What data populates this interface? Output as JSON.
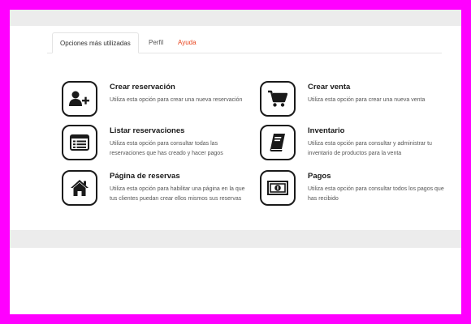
{
  "tabs": [
    {
      "label": "Opciones más utilizadas",
      "active": true
    },
    {
      "label": "Perfil",
      "active": false
    },
    {
      "label": "Ayuda",
      "active": false
    }
  ],
  "accent_color": "#e8441d",
  "frame_color": "#ff00ff",
  "options": [
    {
      "title": "Crear reservación",
      "description": "Utiliza esta opción para crear una nueva reservación",
      "icon": "add-user-icon"
    },
    {
      "title": "Crear venta",
      "description": "Utiliza esta opción para crear una nueva venta",
      "icon": "shopping-cart-icon"
    },
    {
      "title": "Listar reservaciones",
      "description": "Utiliza esta opción para consultar todas las reservaciones que has creado y hacer pagos",
      "icon": "list-icon"
    },
    {
      "title": "Inventario",
      "description": "Utiliza esta opción para consultar y administrar tu inventario de productos para la venta",
      "icon": "book-icon"
    },
    {
      "title": "Página de reservas",
      "description": "Utiliza esta opción para habilitar una página en la que tus clientes puedan crear ellos mismos sus reservas",
      "icon": "home-icon"
    },
    {
      "title": "Pagos",
      "description": "Utiliza esta opción para consultar todos los pagos que has recibido",
      "icon": "money-icon"
    }
  ]
}
